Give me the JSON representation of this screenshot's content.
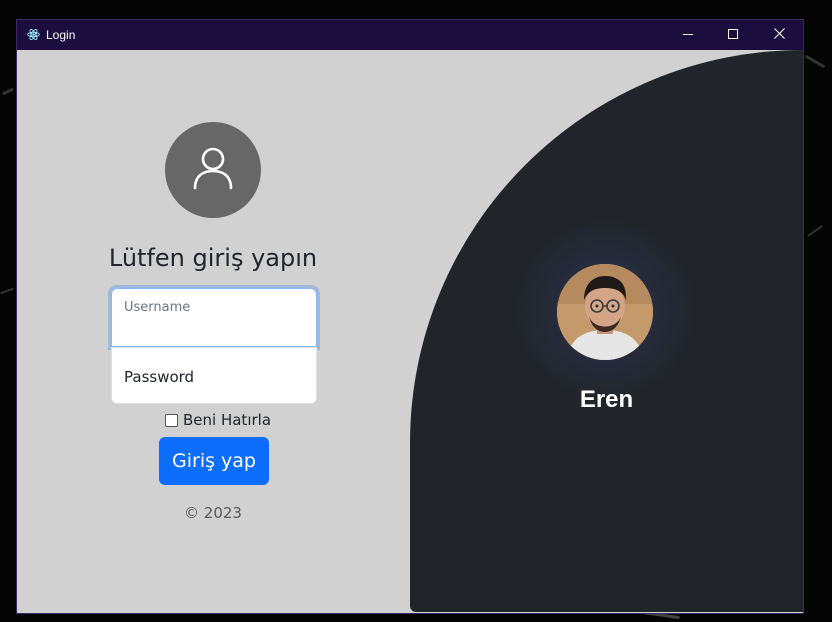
{
  "window": {
    "title": "Login"
  },
  "login": {
    "heading": "Lütfen giriş yapın",
    "username_label": "Username",
    "username_value": "",
    "password_placeholder": "Password",
    "remember_label": "Beni Hatırla",
    "remember_checked": false,
    "submit_label": "Giriş yap",
    "copyright": "© 2023"
  },
  "profile": {
    "name": "Eren"
  },
  "icons": {
    "app": "electron-icon",
    "avatar": "user-icon",
    "minimize": "minimize-icon",
    "maximize": "maximize-icon",
    "close": "close-icon"
  },
  "colors": {
    "titlebar": "#1c0d3f",
    "window_bg": "#d1d1d1",
    "panel_bg": "#212529",
    "primary": "#0d6efd",
    "avatar_bg": "#676767"
  }
}
